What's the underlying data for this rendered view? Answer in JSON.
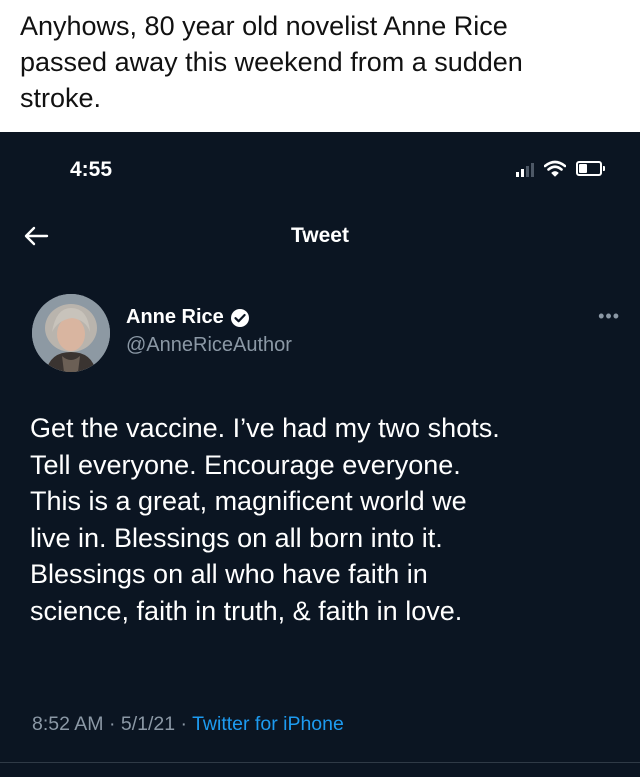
{
  "caption": {
    "lines": [
      "Anyhows, 80 year old novelist Anne Rice",
      "passed away this weekend from a sudden",
      "stroke."
    ]
  },
  "status_bar": {
    "time": "4:55",
    "signal_icon": "cellular-signal-icon",
    "wifi_icon": "wifi-icon",
    "battery_icon": "battery-icon"
  },
  "nav": {
    "back_icon": "back-arrow-icon",
    "title": "Tweet"
  },
  "tweet": {
    "author": {
      "name": "Anne Rice",
      "handle": "@AnneRiceAuthor",
      "verified_icon": "verified-badge-icon"
    },
    "more_label": "•••",
    "text_lines": [
      "Get the vaccine. I’ve had my two shots.",
      "Tell everyone. Encourage everyone.",
      "This is a great, magnificent world we",
      "live in. Blessings on all born into it.",
      "Blessings on all who have faith in",
      "science, faith in truth, & faith in love."
    ],
    "time": "8:52 AM",
    "separator": " · ",
    "date": "5/1/21",
    "source": "Twitter for iPhone"
  },
  "colors": {
    "background": "#0b1522",
    "text": "#ffffff",
    "secondary_text": "#8b98a5",
    "link": "#1d9bf0",
    "caption_background": "#ffffff"
  }
}
